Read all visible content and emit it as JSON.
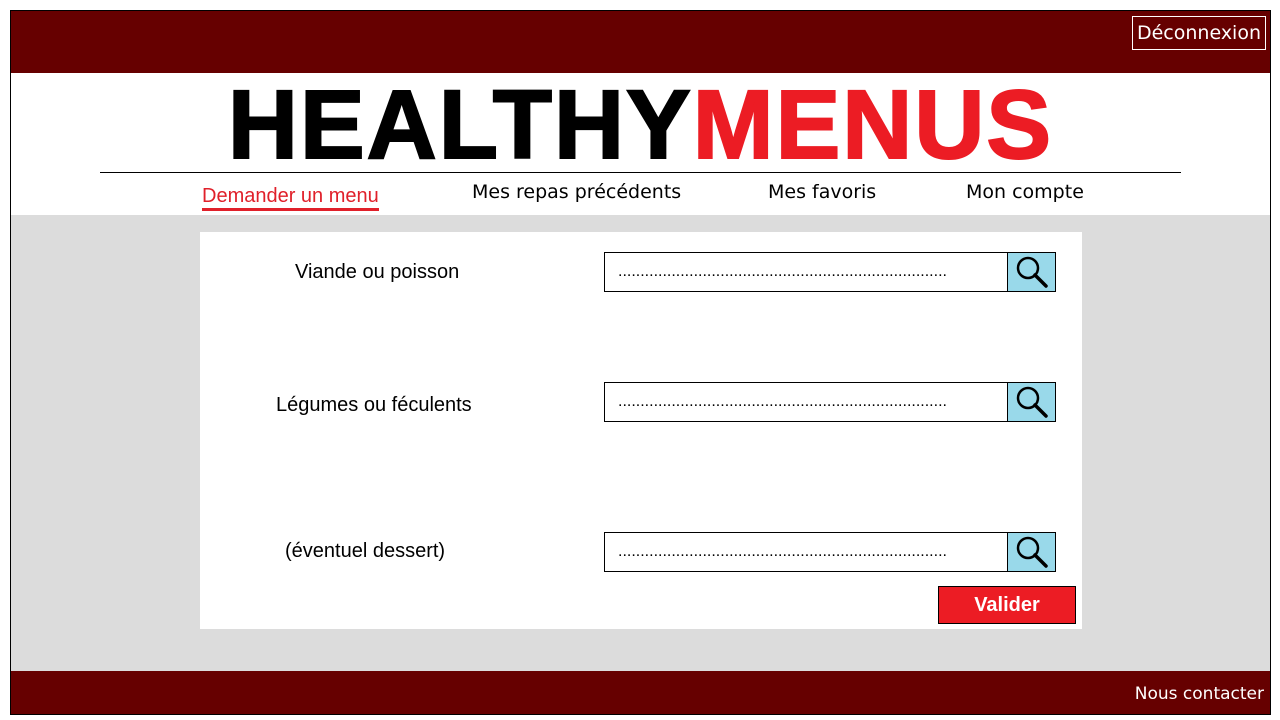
{
  "topbar": {
    "logout_label": "Déconnexion"
  },
  "logo": {
    "part1": "HEALTHY",
    "part2": "MENUS"
  },
  "nav": {
    "items": [
      {
        "label": "Demander un menu",
        "active": true
      },
      {
        "label": "Mes repas précédents"
      },
      {
        "label": "Mes favoris"
      },
      {
        "label": "Mon compte"
      }
    ]
  },
  "form": {
    "fields": [
      {
        "label": "Viande ou poisson",
        "value": "..........................................................................",
        "icon": "search-icon"
      },
      {
        "label": "Légumes ou féculents",
        "value": "..........................................................................",
        "icon": "search-icon"
      },
      {
        "label": "(éventuel dessert)",
        "value": "..........................................................................",
        "icon": "search-icon"
      }
    ],
    "submit_label": "Valider"
  },
  "footer": {
    "contact_label": "Nous contacter"
  },
  "colors": {
    "bar": "#660000",
    "accent_red": "#ec1c24",
    "search_button": "#99d9ea",
    "background": "#dcdcdc"
  }
}
